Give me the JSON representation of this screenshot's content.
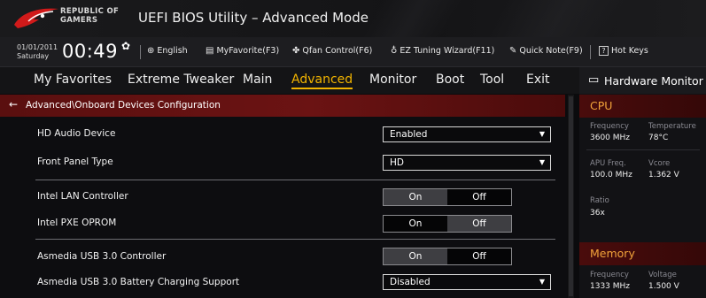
{
  "brand": {
    "line1": "REPUBLIC OF",
    "line2": "GAMERS"
  },
  "window": {
    "title": "UEFI BIOS Utility – Advanced Mode"
  },
  "infobar": {
    "date": "01/01/2011",
    "day": "Saturday",
    "time": "00:49",
    "language": "English",
    "myfavorite": "MyFavorite(F3)",
    "qfan": "Qfan Control(F6)",
    "ez_tuning": "EZ Tuning Wizard(F11)",
    "quick_note": "Quick Note(F9)",
    "hot_keys": "Hot Keys",
    "hot_keys_glyph": "?"
  },
  "menu": {
    "tabs": [
      {
        "label": "My Favorites"
      },
      {
        "label": "Extreme Tweaker"
      },
      {
        "label": "Main"
      },
      {
        "label": "Advanced"
      },
      {
        "label": "Monitor"
      },
      {
        "label": "Boot"
      },
      {
        "label": "Tool"
      },
      {
        "label": "Exit"
      }
    ],
    "active": "Advanced"
  },
  "breadcrumb": "Advanced\\Onboard Devices Configuration",
  "settings": {
    "hd_audio": {
      "label": "HD Audio Device",
      "value": "Enabled"
    },
    "front_panel": {
      "label": "Front Panel Type",
      "value": "HD"
    },
    "intel_lan": {
      "label": "Intel LAN Controller",
      "on": "On",
      "off": "Off",
      "selected": "On"
    },
    "intel_pxe": {
      "label": "Intel PXE OPROM",
      "on": "On",
      "off": "Off",
      "selected": "Off"
    },
    "asmedia_usb3": {
      "label": "Asmedia USB 3.0 Controller",
      "on": "On",
      "off": "Off",
      "selected": "On"
    },
    "asmedia_batt": {
      "label": "Asmedia USB 3.0 Battery Charging Support",
      "value": "Disabled"
    }
  },
  "hardware_monitor": {
    "title": "Hardware Monitor",
    "cpu": {
      "heading": "CPU",
      "frequency_label": "Frequency",
      "frequency": "3600 MHz",
      "temperature_label": "Temperature",
      "temperature": "78°C",
      "apu_label": "APU Freq.",
      "apu": "100.0 MHz",
      "vcore_label": "Vcore",
      "vcore": "1.362 V",
      "ratio_label": "Ratio",
      "ratio": "36x"
    },
    "memory": {
      "heading": "Memory",
      "frequency_label": "Frequency",
      "frequency": "1333 MHz",
      "voltage_label": "Voltage",
      "voltage": "1.500 V"
    }
  },
  "colors": {
    "accent": "#f2b400",
    "crumb": "#6b1313",
    "hw_heading": "#f2a33a"
  }
}
